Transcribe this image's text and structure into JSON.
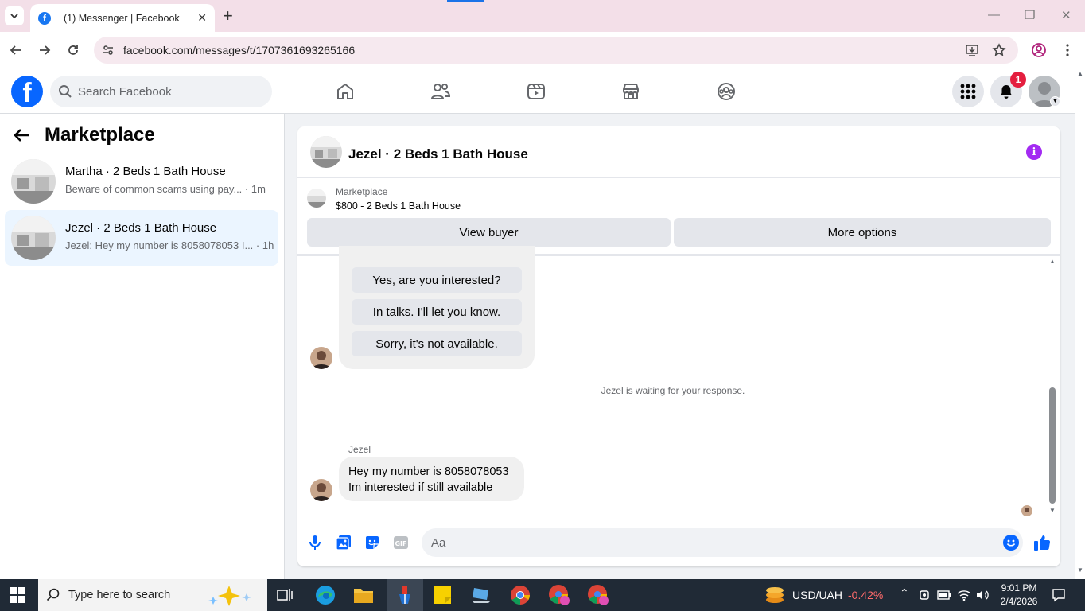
{
  "browser": {
    "tab_title": "(1) Messenger | Facebook",
    "url": "facebook.com/messages/t/1707361693265166"
  },
  "fb": {
    "search_placeholder": "Search Facebook",
    "notification_count": "1"
  },
  "sidebar": {
    "title": "Marketplace",
    "conversations": [
      {
        "name": "Martha · 2 Beds 1 Bath House",
        "snippet": "Beware of common scams using pay... · 1m",
        "active": false
      },
      {
        "name": "Jezel · 2 Beds 1 Bath House",
        "snippet": "Jezel: Hey my number is 8058078053 I... · 1h",
        "active": true
      }
    ]
  },
  "chat": {
    "title": "Jezel · 2 Beds 1 Bath House",
    "marketplace_label": "Marketplace",
    "listing": "$800 - 2 Beds 1 Bath House",
    "view_buyer": "View buyer",
    "more_options": "More options",
    "quick_replies": [
      "Yes, are you interested?",
      "In talks. I'll let you know.",
      "Sorry, it's not available."
    ],
    "waiting_text": "Jezel is waiting for your response.",
    "sender": "Jezel",
    "message_line1": "Hey my number is 8058078053",
    "message_line2": "Im interested if still available",
    "composer_placeholder": "Aa"
  },
  "taskbar": {
    "search_placeholder": "Type here to search",
    "ticker_pair": "USD/UAH",
    "ticker_change": "-0.42%",
    "time": "9:01 PM",
    "date": "2/4/2026"
  },
  "colors": {
    "fb_blue": "#0866ff",
    "active_conv": "#ebf5ff",
    "badge_red": "#e41e3f",
    "info_purple": "#a32bf2",
    "ticker_red": "#ff6b6b"
  }
}
